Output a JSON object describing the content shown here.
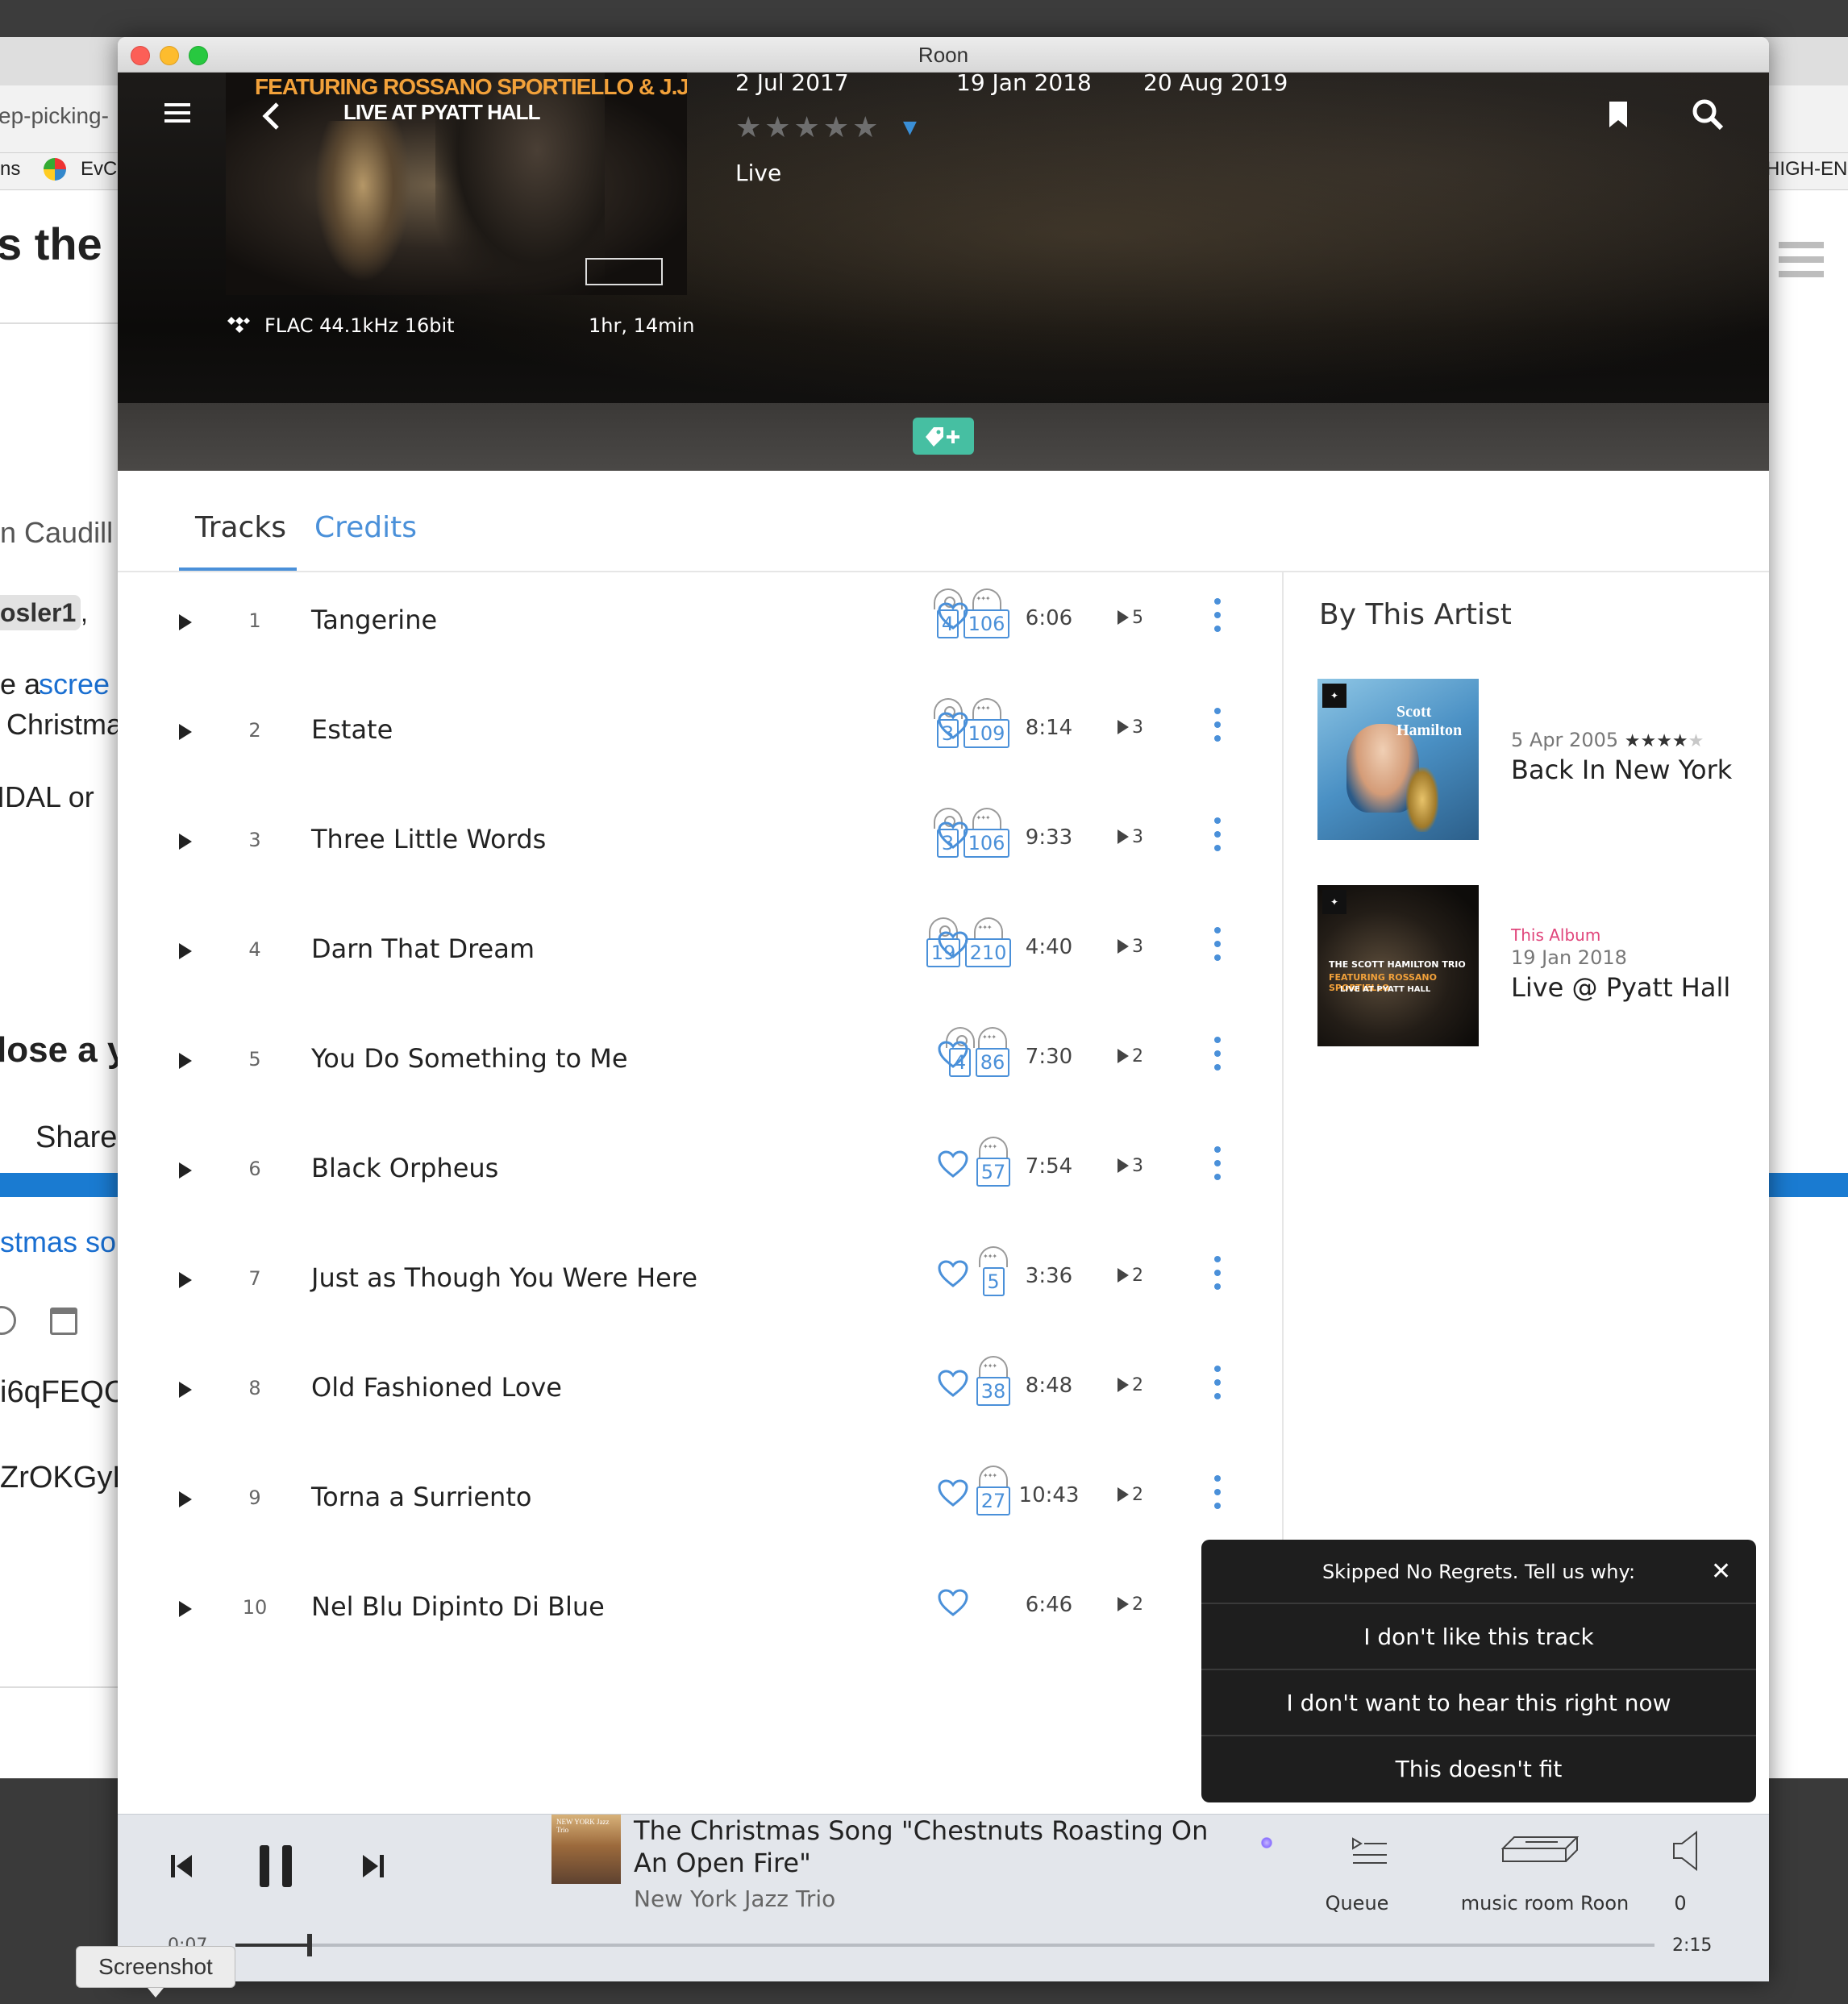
{
  "background_browser": {
    "url_fragment": "ep-picking-",
    "bookmark_left_1": "ns",
    "bookmark_left_2": "EvC",
    "bookmark_right": "HIGH-EN",
    "heading": "s the r",
    "author": "n Caudill",
    "mention": "osler1",
    "mention_comma": ",",
    "line_a": "e a",
    "line_a_link": "scree",
    "line_b": "Christma",
    "line_c": "IDAL or",
    "heading2": "lose a y",
    "share": "Share",
    "link2": "stmas so",
    "code1": "i6qFEQC",
    "code2": "ZrOKGyH"
  },
  "window": {
    "title": "Roon"
  },
  "album_header": {
    "cover_line1": "FEATURING ROSSANO SPORTIELLO & J.J. SHAKUR",
    "cover_line2": "LIVE AT PYATT HALL",
    "format": "FLAC 44.1kHz 16bit",
    "duration": "1hr, 14min",
    "dates": [
      "2 Jul 2017",
      "19 Jan 2018",
      "20 Aug 2019"
    ],
    "stars": "★★★★★",
    "star_caret": "▼",
    "genre": "Live"
  },
  "tabs": {
    "tracks": "Tracks",
    "credits": "Credits"
  },
  "tracks": [
    {
      "num": "1",
      "title": "Tangerine",
      "cd": "4",
      "tidal": "106",
      "length": "6:06",
      "plays": "5"
    },
    {
      "num": "2",
      "title": "Estate",
      "cd": "3",
      "tidal": "109",
      "length": "8:14",
      "plays": "3"
    },
    {
      "num": "3",
      "title": "Three Little Words",
      "cd": "3",
      "tidal": "106",
      "length": "9:33",
      "plays": "3"
    },
    {
      "num": "4",
      "title": "Darn That Dream",
      "cd": "19",
      "tidal": "210",
      "length": "4:40",
      "plays": "3"
    },
    {
      "num": "5",
      "title": "You Do Something to Me",
      "cd": "4",
      "tidal": "86",
      "length": "7:30",
      "plays": "2"
    },
    {
      "num": "6",
      "title": "Black Orpheus",
      "cd": "",
      "tidal": "57",
      "length": "7:54",
      "plays": "3"
    },
    {
      "num": "7",
      "title": "Just as Though You Were Here",
      "cd": "",
      "tidal": "5",
      "length": "3:36",
      "plays": "2"
    },
    {
      "num": "8",
      "title": "Old Fashioned Love",
      "cd": "",
      "tidal": "38",
      "length": "8:48",
      "plays": "2"
    },
    {
      "num": "9",
      "title": "Torna a Surriento",
      "cd": "",
      "tidal": "27",
      "length": "10:43",
      "plays": "2"
    },
    {
      "num": "10",
      "title": "Nel Blu Dipinto Di Blue",
      "cd": "",
      "tidal": "",
      "length": "6:46",
      "plays": "2"
    }
  ],
  "by_artist": {
    "title": "By This Artist",
    "albums": [
      {
        "cover_text": "Scott Hamilton",
        "date": "5 Apr 2005",
        "stars": "★★★★",
        "stars_dim": "★",
        "title": "Back In New York",
        "tag": ""
      },
      {
        "cover_text": "THE SCOTT HAMILTON TRIO",
        "cover_text2": "FEATURING ROSSANO SPORTIELLO",
        "cover_text3": "LIVE AT PYATT HALL",
        "date": "19 Jan 2018",
        "title": "Live @ Pyatt Hall",
        "tag": "This Album"
      }
    ]
  },
  "skip_popup": {
    "prefix": "Skipped",
    "track": "No Regrets",
    "suffix": ". Tell us why:",
    "close": "✕",
    "options": [
      "I don't like this track",
      "I don't want to hear this right now",
      "This doesn't fit"
    ]
  },
  "player": {
    "art_text": "NEW YORK Jazz Trio",
    "title": "The Christmas Song \"Chestnuts Roasting On An Open Fire\"",
    "artist": "New York Jazz Trio",
    "queue_label": "Queue",
    "zone_label": "music room Roon",
    "volume": "0",
    "elapsed": "0:07",
    "total": "2:15",
    "progress": 0.052
  },
  "tooltip": "Screenshot"
}
